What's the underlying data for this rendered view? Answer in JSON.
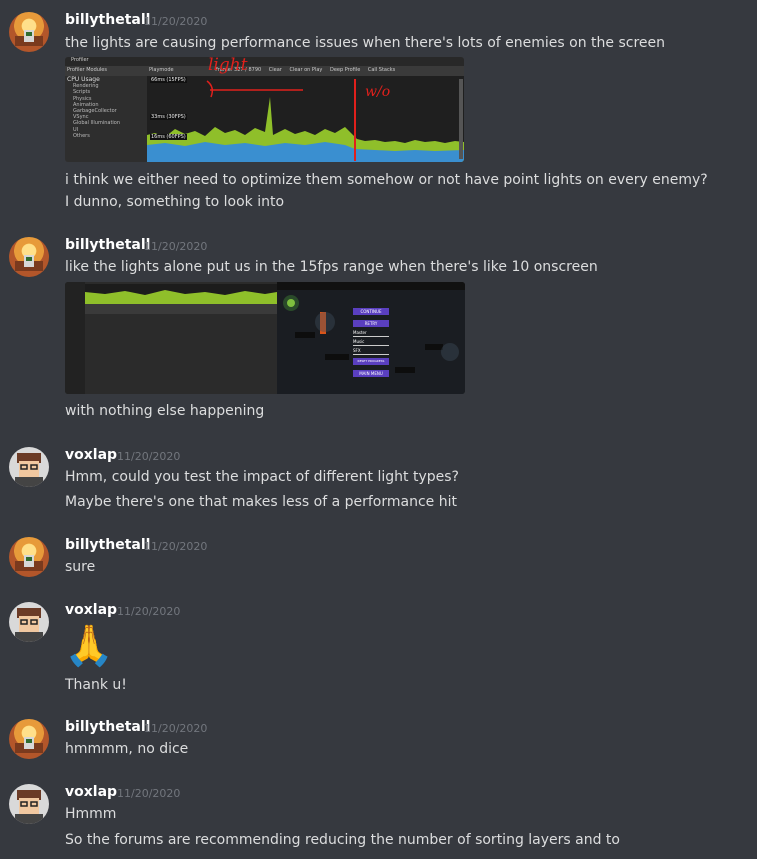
{
  "messages": [
    {
      "user": "billythetall",
      "time": "11/20/2020",
      "lines": [
        "the lights are causing performance issues when there's lots of enemies on the screen",
        "i think we either need to optimize them somehow or not have point lights on every enemy?",
        "I dunno, something to look into"
      ],
      "image": {
        "tab": "Profiler",
        "modules_label": "Profiler Modules",
        "toolbar": [
          "Playmode",
          "Frame: 327 / 8790",
          "Clear",
          "Clear on Play",
          "Deep Profile",
          "Call Stacks"
        ],
        "sidebar": [
          "CPU Usage",
          "Rendering",
          "Scripts",
          "Physics",
          "Animation",
          "GarbageCollector",
          "VSync",
          "Global Illumination",
          "UI",
          "Others"
        ],
        "labels": [
          "66ms (15FPS)",
          "33ms (30FPS)",
          "16ms (60FPS)"
        ],
        "annotation_left": "light",
        "annotation_right": "w/o"
      }
    },
    {
      "user": "billythetall",
      "time": "11/20/2020",
      "lines": [
        "like the lights alone put us in the 15fps range when there's like 10 onscreen",
        "with nothing else happening"
      ],
      "image": {
        "menu": [
          "CONTINUE",
          "RETRY",
          "Master",
          "Music",
          "SFX",
          "RESET PROGRESS",
          "MAIN MENU"
        ]
      }
    },
    {
      "user": "voxlap",
      "time": "11/20/2020",
      "lines": [
        "Hmm, could you test the impact of different light types?",
        "Maybe there's one that makes less of a performance hit"
      ]
    },
    {
      "user": "billythetall",
      "time": "11/20/2020",
      "lines": [
        "sure"
      ]
    },
    {
      "user": "voxlap",
      "time": "11/20/2020",
      "lines": [
        "🙏",
        "Thank u!"
      ]
    },
    {
      "user": "billythetall",
      "time": "11/20/2020",
      "lines": [
        "hmmmm, no dice"
      ]
    },
    {
      "user": "voxlap",
      "time": "11/20/2020",
      "lines": [
        "Hmmm",
        "So the forums are recommending reducing the number of sorting layers and to"
      ]
    }
  ],
  "colors": {
    "background": "#36393f",
    "username": "#ffffff",
    "timestamp": "#72767d",
    "text": "#dcddde",
    "annotation_red": "#e0201c"
  }
}
